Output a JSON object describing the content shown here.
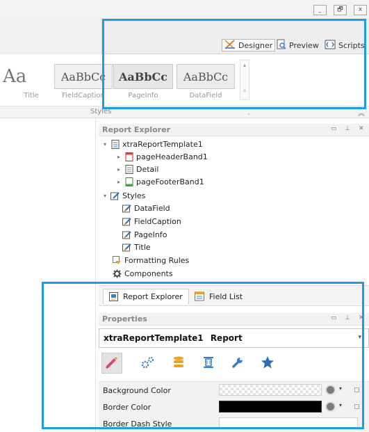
{
  "window": {
    "minimize_glyph": "_",
    "restore_glyph": "🗗",
    "close_glyph": "x"
  },
  "view_buttons": [
    {
      "label": "Designer",
      "icon": "designer-icon",
      "active": true
    },
    {
      "label": "Preview",
      "icon": "preview-icon",
      "active": false
    },
    {
      "label": "Scripts",
      "icon": "scripts-icon",
      "active": false
    }
  ],
  "styles_gallery": {
    "items": [
      {
        "sample": "Aa",
        "caption": "Title"
      },
      {
        "sample": "AaBbCc",
        "caption": "FieldCaption"
      },
      {
        "sample": "AaBbCc",
        "caption": "PageInfo"
      },
      {
        "sample": "AaBbCc",
        "caption": "DataField"
      }
    ],
    "group_label": "Styles"
  },
  "report_explorer": {
    "title": "Report Explorer",
    "tree": [
      {
        "label": "xtraReportTemplate1",
        "level": 0,
        "toggle": "▾",
        "icon": "report-icon"
      },
      {
        "label": "pageHeaderBand1",
        "level": 1,
        "toggle": "▸",
        "icon": "page-header-band-icon"
      },
      {
        "label": "Detail",
        "level": 1,
        "toggle": "▸",
        "icon": "detail-band-icon"
      },
      {
        "label": "pageFooterBand1",
        "level": 1,
        "toggle": "▸",
        "icon": "page-footer-band-icon"
      },
      {
        "label": "Styles",
        "level": 0,
        "toggle": "▾",
        "icon": "styles-icon"
      },
      {
        "label": "DataField",
        "level": 1,
        "toggle": "",
        "icon": "style-item-icon"
      },
      {
        "label": "FieldCaption",
        "level": 1,
        "toggle": "",
        "icon": "style-item-icon"
      },
      {
        "label": "PageInfo",
        "level": 1,
        "toggle": "",
        "icon": "style-item-icon"
      },
      {
        "label": "Title",
        "level": 1,
        "toggle": "",
        "icon": "style-item-icon"
      },
      {
        "label": "Formatting Rules",
        "level": 0,
        "toggle": "",
        "icon": "formatting-rules-icon"
      },
      {
        "label": "Components",
        "level": 0,
        "toggle": "",
        "icon": "components-icon"
      }
    ]
  },
  "panel_tabs": [
    {
      "label": "Report Explorer",
      "icon": "report-explorer-icon",
      "active": true
    },
    {
      "label": "Field List",
      "icon": "field-list-icon",
      "active": false
    }
  ],
  "properties": {
    "title": "Properties",
    "object_name": "xtraReportTemplate1",
    "object_type": "Report",
    "rows": [
      {
        "name": "Background Color",
        "value_color": "transparent"
      },
      {
        "name": "Border Color",
        "value_color": "#000000"
      },
      {
        "name": "Border Dash Style",
        "value_color": ""
      }
    ]
  },
  "accent_color": "#1aa0e0"
}
